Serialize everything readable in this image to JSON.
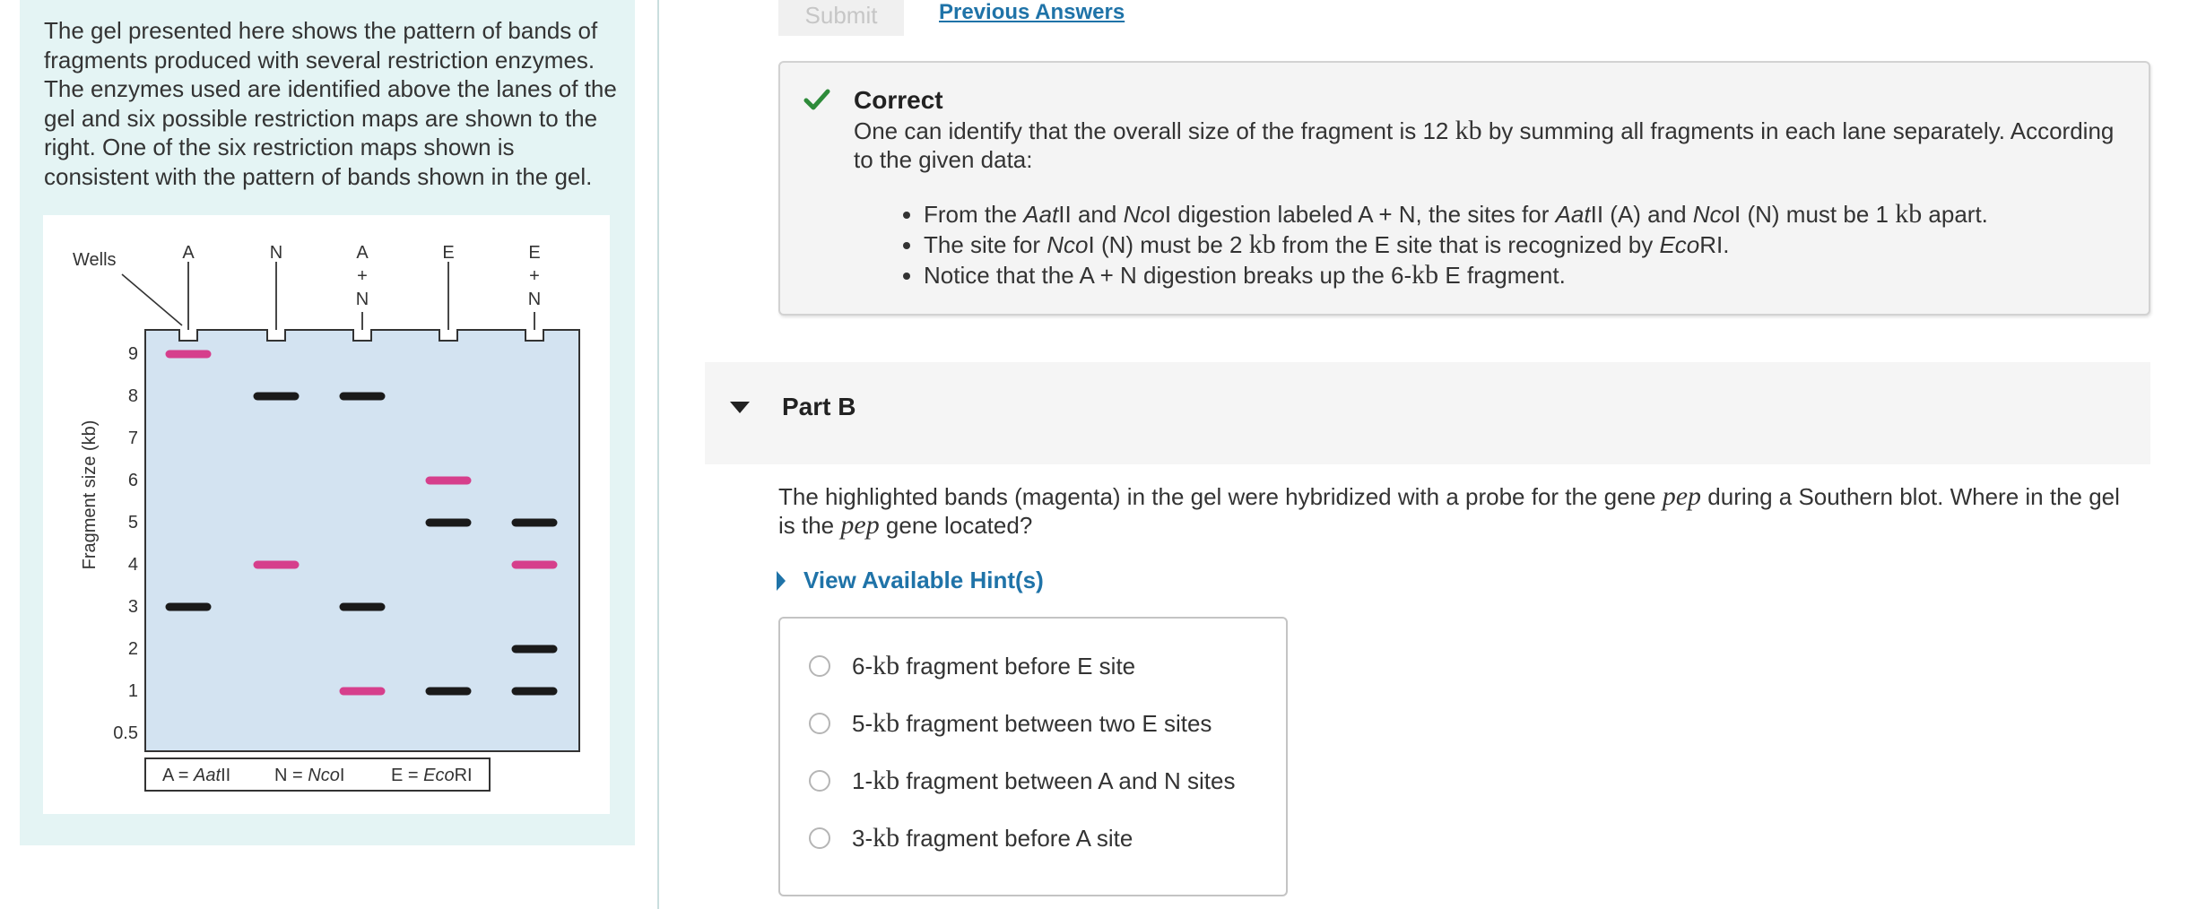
{
  "intro_text": "The gel presented here shows the pattern of bands of fragments produced with several restriction enzymes. The enzymes used are identified above the lanes of the gel and six possible restriction maps are shown to the right. One of the six restriction maps shown is consistent with the pattern of bands shown in the gel.",
  "gel": {
    "wells_label": "Wells",
    "y_axis_label": "Fragment size (kb)",
    "lanes": [
      {
        "label": [
          "A"
        ]
      },
      {
        "label": [
          "N"
        ]
      },
      {
        "label": [
          "A",
          "+",
          "N"
        ]
      },
      {
        "label": [
          "E"
        ]
      },
      {
        "label": [
          "E",
          "+",
          "N"
        ]
      }
    ],
    "y_ticks": [
      "9",
      "8",
      "7",
      "6",
      "5",
      "4",
      "3",
      "2",
      "1",
      "0.5"
    ],
    "bands": [
      {
        "lane": 0,
        "kb": 9,
        "color": "magenta"
      },
      {
        "lane": 0,
        "kb": 3,
        "color": "black"
      },
      {
        "lane": 1,
        "kb": 8,
        "color": "black"
      },
      {
        "lane": 1,
        "kb": 4,
        "color": "magenta"
      },
      {
        "lane": 2,
        "kb": 8,
        "color": "black"
      },
      {
        "lane": 2,
        "kb": 3,
        "color": "black"
      },
      {
        "lane": 2,
        "kb": 1,
        "color": "magenta"
      },
      {
        "lane": 3,
        "kb": 6,
        "color": "magenta"
      },
      {
        "lane": 3,
        "kb": 5,
        "color": "black"
      },
      {
        "lane": 3,
        "kb": 1,
        "color": "black"
      },
      {
        "lane": 4,
        "kb": 5,
        "color": "black"
      },
      {
        "lane": 4,
        "kb": 4,
        "color": "magenta"
      },
      {
        "lane": 4,
        "kb": 2,
        "color": "black"
      },
      {
        "lane": 4,
        "kb": 1,
        "color": "black"
      }
    ],
    "legend": {
      "a": {
        "prefix": "A = ",
        "name": "Aat",
        "suffix": "II"
      },
      "n": {
        "prefix": "N = ",
        "name": "Nco",
        "suffix": "I"
      },
      "e": {
        "prefix": "E = ",
        "name": "Eco",
        "suffix": "RI"
      }
    },
    "colors": {
      "gel_fill": "#d3e3f1",
      "magenta": "#d63f8c",
      "black": "#1a1a1a"
    }
  },
  "toolbar": {
    "submit_label": "Submit",
    "previous_answers_label": "Previous Answers"
  },
  "feedback": {
    "title": "Correct",
    "text_a": "One can identify that the overall size of the fragment is 12 ",
    "unit": "kb",
    "text_b": " by summing all fragments in each lane separately. According to the given data:",
    "bullet1": {
      "t1": "From the ",
      "e1": "Aat",
      "t2": "II and ",
      "e2": "Nco",
      "t3": "I digestion labeled A + N, the sites for ",
      "e3": "Aat",
      "t4": "II (A) and ",
      "e4": "Nco",
      "t5": "I (N) must be 1 ",
      "t6": " apart."
    },
    "bullet2": {
      "t1": "The site for ",
      "e1": "Nco",
      "t2": "I (N) must be 2 ",
      "t3": " from the E site that is recognized by ",
      "e2": "Eco",
      "t4": "RI."
    },
    "bullet3": {
      "t1": "Notice that the A + N digestion breaks up the 6-",
      "t2": " E fragment."
    }
  },
  "part_b": {
    "title": "Part B",
    "question_a": "The highlighted bands (magenta) in the gel were hybridized with a probe for the gene ",
    "gene": "pep",
    "question_b": " during a Southern blot. Where in the gel is the ",
    "question_c": " gene located?",
    "hint_label": "View Available Hint(s)",
    "options": [
      {
        "size": "6-",
        "unit": "kb",
        "text": " fragment before E site"
      },
      {
        "size": "5-",
        "unit": "kb",
        "text": " fragment between two E sites"
      },
      {
        "size": "1-",
        "unit": "kb",
        "text": " fragment between A and N sites"
      },
      {
        "size": "3-",
        "unit": "kb",
        "text": " fragment before A site"
      }
    ]
  },
  "accent_color": "#1f73a8",
  "correct_color": "#2e8b3a"
}
